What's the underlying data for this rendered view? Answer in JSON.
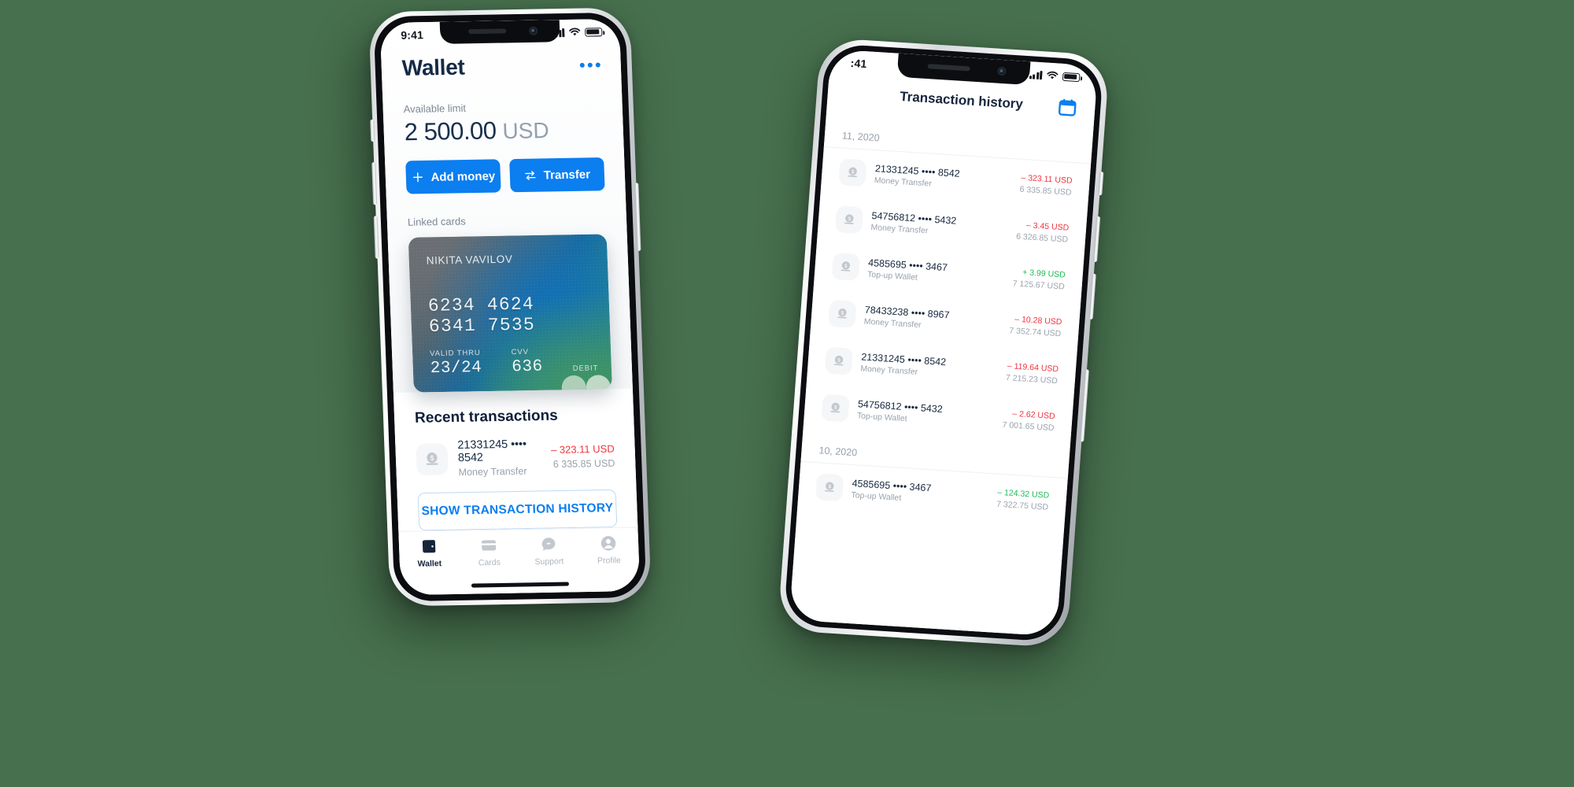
{
  "background_color": "#47704e",
  "accent_color": "#0b7ef0",
  "negative_color": "#f0323c",
  "positive_color": "#1db954",
  "wallet_phone": {
    "status_bar": {
      "time": "9:41",
      "signal_icon": "cellular-signal-icon",
      "wifi_icon": "wifi-icon",
      "battery_icon": "battery-full-icon"
    },
    "header": {
      "title": "Wallet",
      "more_icon": "more-options-icon"
    },
    "balance": {
      "label": "Available limit",
      "amount": "2 500.00",
      "currency": "USD"
    },
    "actions": [
      {
        "label": "Add money",
        "icon": "plus-icon"
      },
      {
        "label": "Transfer",
        "icon": "transfer-arrows-icon"
      }
    ],
    "linked_cards": {
      "label": "Linked cards",
      "card": {
        "holder": "NIKITA VAVILOV",
        "number": "6234 4624 6341 7535",
        "valid_thru_label": "VALID THRU",
        "valid_thru": "23/24",
        "cvv_label": "CVV",
        "cvv": "636",
        "type_label": "DEBIT",
        "brand_icon": "mastercard-logo-icon"
      }
    },
    "recent": {
      "title": "Recent transactions",
      "transactions": [
        {
          "icon": "money-coin-icon",
          "account": "21331245 •••• 8542",
          "category": "Money Transfer",
          "amount": "– 323.11 USD",
          "sign": "neg",
          "balance": "6 335.85  USD"
        }
      ],
      "show_history_button": "SHOW TRANSACTION HISTORY"
    },
    "tabbar": [
      {
        "label": "Wallet",
        "icon": "wallet-icon",
        "active": true
      },
      {
        "label": "Cards",
        "icon": "card-icon",
        "active": false
      },
      {
        "label": "Support",
        "icon": "support-chat-icon",
        "active": false
      },
      {
        "label": "Profile",
        "icon": "profile-icon",
        "active": false
      }
    ]
  },
  "history_phone": {
    "status_bar": {
      "time": ":41",
      "signal_icon": "cellular-signal-icon",
      "wifi_icon": "wifi-icon",
      "battery_icon": "battery-full-icon"
    },
    "header": {
      "title": "Transaction history",
      "calendar_icon": "calendar-icon"
    },
    "groups": [
      {
        "date": "11, 2020",
        "rows": [
          {
            "icon": "money-coin-icon",
            "account": "21331245 •••• 8542",
            "category": "Money Transfer",
            "amount": "– 323.11 USD",
            "sign": "neg",
            "balance": "6 335.85  USD"
          },
          {
            "icon": "money-coin-icon",
            "account": "54756812 •••• 5432",
            "category": "Money Transfer",
            "amount": "– 3.45 USD",
            "sign": "neg",
            "balance": "6 326.85  USD"
          },
          {
            "icon": "money-coin-icon",
            "account": "4585695 •••• 3467",
            "category": "Top-up Wallet",
            "amount": "+ 3.99 USD",
            "sign": "pos",
            "balance": "7 125.67  USD"
          },
          {
            "icon": "money-coin-icon",
            "account": "78433238 •••• 8967",
            "category": "Money Transfer",
            "amount": "– 10.28 USD",
            "sign": "neg",
            "balance": "7 352.74  USD"
          },
          {
            "icon": "money-coin-icon",
            "account": "21331245 •••• 8542",
            "category": "Money Transfer",
            "amount": "– 119.64 USD",
            "sign": "neg",
            "balance": "7 215.23  USD"
          },
          {
            "icon": "money-coin-icon",
            "account": "54756812 •••• 5432",
            "category": "Top-up Wallet",
            "amount": "– 2.62 USD",
            "sign": "neg",
            "balance": "7 001.65  USD"
          }
        ]
      },
      {
        "date": "10, 2020",
        "rows": [
          {
            "icon": "money-coin-icon",
            "account": "4585695 •••• 3467",
            "category": "Top-up Wallet",
            "amount": "– 124.32 USD",
            "sign": "pos",
            "balance": "7 322.75  USD"
          }
        ]
      }
    ]
  }
}
